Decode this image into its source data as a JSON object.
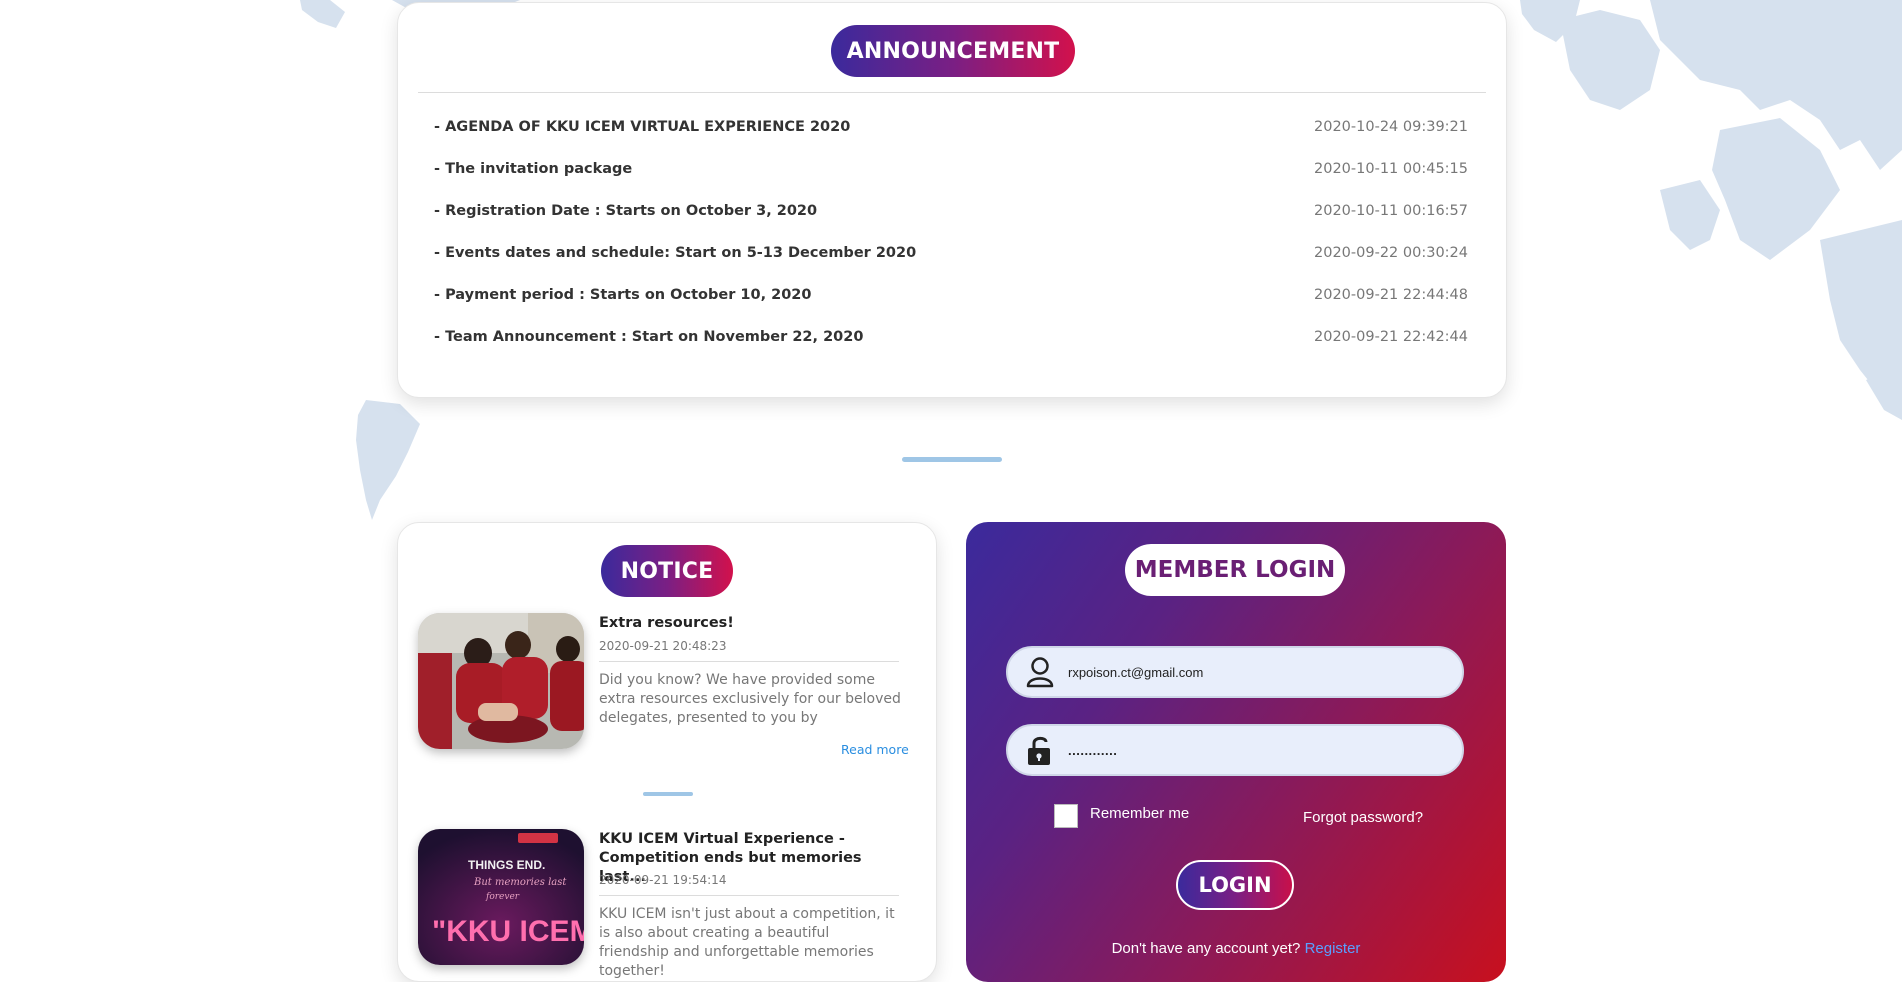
{
  "announcement": {
    "title": "ANNOUNCEMENT",
    "items": [
      {
        "title": "- AGENDA OF KKU ICEM VIRTUAL EXPERIENCE 2020",
        "date": "2020-10-24 09:39:21"
      },
      {
        "title": "- The invitation package",
        "date": "2020-10-11 00:45:15"
      },
      {
        "title": "- Registration Date : Starts on October 3, 2020",
        "date": "2020-10-11 00:16:57"
      },
      {
        "title": "- Events dates and schedule: Start on 5-13 December 2020",
        "date": "2020-09-22 00:30:24"
      },
      {
        "title": "- Payment period : Starts on October 10, 2020",
        "date": "2020-09-21 22:44:48"
      },
      {
        "title": "- Team Announcement : Start on November 22, 2020",
        "date": "2020-09-21 22:42:44"
      }
    ]
  },
  "notice": {
    "title": "NOTICE",
    "items": [
      {
        "title": "Extra resources!",
        "date": "2020-09-21 20:48:23",
        "body": "Did you know? We have provided some extra resources exclusively for our beloved delegates, presented to you by professors...",
        "read_more": "Read more"
      },
      {
        "title": "KKU ICEM Virtual Experience - Competition ends but memories last...",
        "date": "2020-09-21 19:54:14",
        "body": "KKU ICEM isn't just about a competition, it is also about creating a beautiful friendship and unforgettable memories together!",
        "image_text": {
          "line1": "THINGS END.",
          "line2": "But memories last",
          "line3": "forever",
          "big": "\"KKU ICEM\""
        }
      }
    ]
  },
  "login": {
    "title": "MEMBER LOGIN",
    "email_value": "rxpoison.ct@gmail.com",
    "password_value": "............",
    "remember_label": "Remember me",
    "forgot_label": "Forgot password?",
    "login_button": "LOGIN",
    "no_account_text": "Don't have any account yet?",
    "register_link": "Register"
  },
  "colors": {
    "gradient_start": "#3b2a9c",
    "gradient_end": "#d2114c",
    "map": "#d4e0ee",
    "divider": "#9fc6e6",
    "link": "#2a8ee0"
  }
}
